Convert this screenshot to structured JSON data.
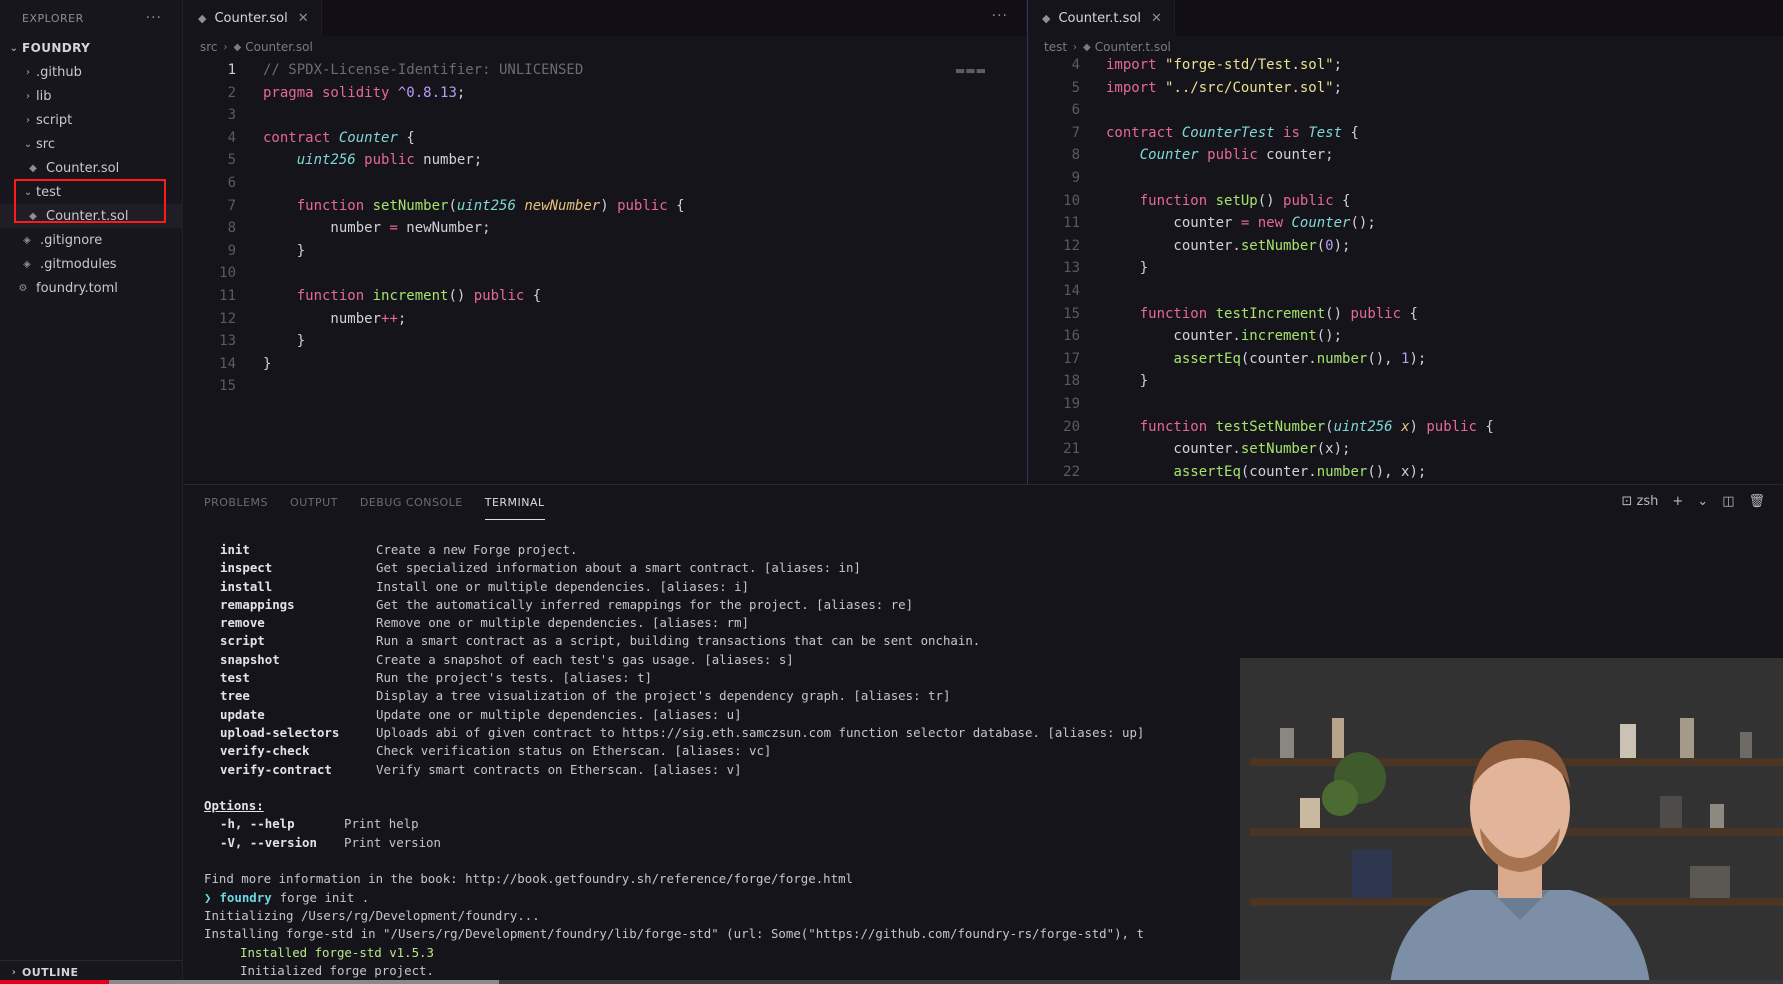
{
  "sidebar": {
    "title": "EXPLORER",
    "more": "···",
    "root": "FOUNDRY",
    "items": [
      {
        "label": ".github",
        "type": "folder",
        "expanded": false,
        "depth": 1
      },
      {
        "label": "lib",
        "type": "folder",
        "expanded": false,
        "depth": 1
      },
      {
        "label": "script",
        "type": "folder",
        "expanded": false,
        "depth": 1
      },
      {
        "label": "src",
        "type": "folder",
        "expanded": true,
        "depth": 1
      },
      {
        "label": "Counter.sol",
        "type": "file",
        "depth": 2
      },
      {
        "label": "test",
        "type": "folder",
        "expanded": true,
        "depth": 1
      },
      {
        "label": "Counter.t.sol",
        "type": "file",
        "depth": 2
      },
      {
        "label": ".gitignore",
        "type": "file",
        "depth": 1
      },
      {
        "label": ".gitmodules",
        "type": "file",
        "depth": 1
      },
      {
        "label": "foundry.toml",
        "type": "gear",
        "depth": 1
      }
    ],
    "outline": "OUTLINE"
  },
  "editor_left": {
    "tab": "Counter.sol",
    "more": "···",
    "breadcrumb": [
      "src",
      "Counter.sol"
    ]
  },
  "editor_right": {
    "tab": "Counter.t.sol",
    "breadcrumb": [
      "test",
      "Counter.t.sol"
    ]
  },
  "panel": {
    "tabs": [
      "PROBLEMS",
      "OUTPUT",
      "DEBUG CONSOLE",
      "TERMINAL"
    ],
    "active_tab": "TERMINAL",
    "shell": "zsh",
    "commands": [
      {
        "name": "init",
        "desc": "Create a new Forge project."
      },
      {
        "name": "inspect",
        "desc": "Get specialized information about a smart contract. [aliases: in]"
      },
      {
        "name": "install",
        "desc": "Install one or multiple dependencies. [aliases: i]"
      },
      {
        "name": "remappings",
        "desc": "Get the automatically inferred remappings for the project. [aliases: re]"
      },
      {
        "name": "remove",
        "desc": "Remove one or multiple dependencies. [aliases: rm]"
      },
      {
        "name": "script",
        "desc": "Run a smart contract as a script, building transactions that can be sent onchain."
      },
      {
        "name": "snapshot",
        "desc": "Create a snapshot of each test's gas usage. [aliases: s]"
      },
      {
        "name": "test",
        "desc": "Run the project's tests. [aliases: t]"
      },
      {
        "name": "tree",
        "desc": "Display a tree visualization of the project's dependency graph. [aliases: tr]"
      },
      {
        "name": "update",
        "desc": "Update one or multiple dependencies. [aliases: u]"
      },
      {
        "name": "upload-selectors",
        "desc": "Uploads abi of given contract to https://sig.eth.samczsun.com function selector database. [aliases: up]"
      },
      {
        "name": "verify-check",
        "desc": "Check verification status on Etherscan. [aliases: vc]"
      },
      {
        "name": "verify-contract",
        "desc": "Verify smart contracts on Etherscan. [aliases: v]"
      }
    ],
    "options_title": "Options:",
    "options": [
      {
        "flag": "-h, --help",
        "desc": "Print help"
      },
      {
        "flag": "-V, --version",
        "desc": "Print version"
      }
    ],
    "more_info": "Find more information in the book: http://book.getfoundry.sh/reference/forge/forge.html",
    "prompt_arrow": "❯",
    "prompt_dir": "foundry",
    "prompt_cmd": "forge init .",
    "init_line": "Initializing /Users/rg/Development/foundry...",
    "installing_line": "Installing forge-std in \"/Users/rg/Development/foundry/lib/forge-std\" (url: Some(\"https://github.com/foundry-rs/forge-std\"), t",
    "installed_line": "Installed forge-std v1.5.3",
    "initialized_line": "Initialized forge project."
  },
  "video": {
    "progress": 0.061,
    "buffered": 0.28
  },
  "colors": {
    "highlight_box": "#ff1a1a",
    "progress": "#e3001a",
    "keyword": "#e6689a",
    "type": "#7fd8d4",
    "function": "#a6e36b"
  }
}
